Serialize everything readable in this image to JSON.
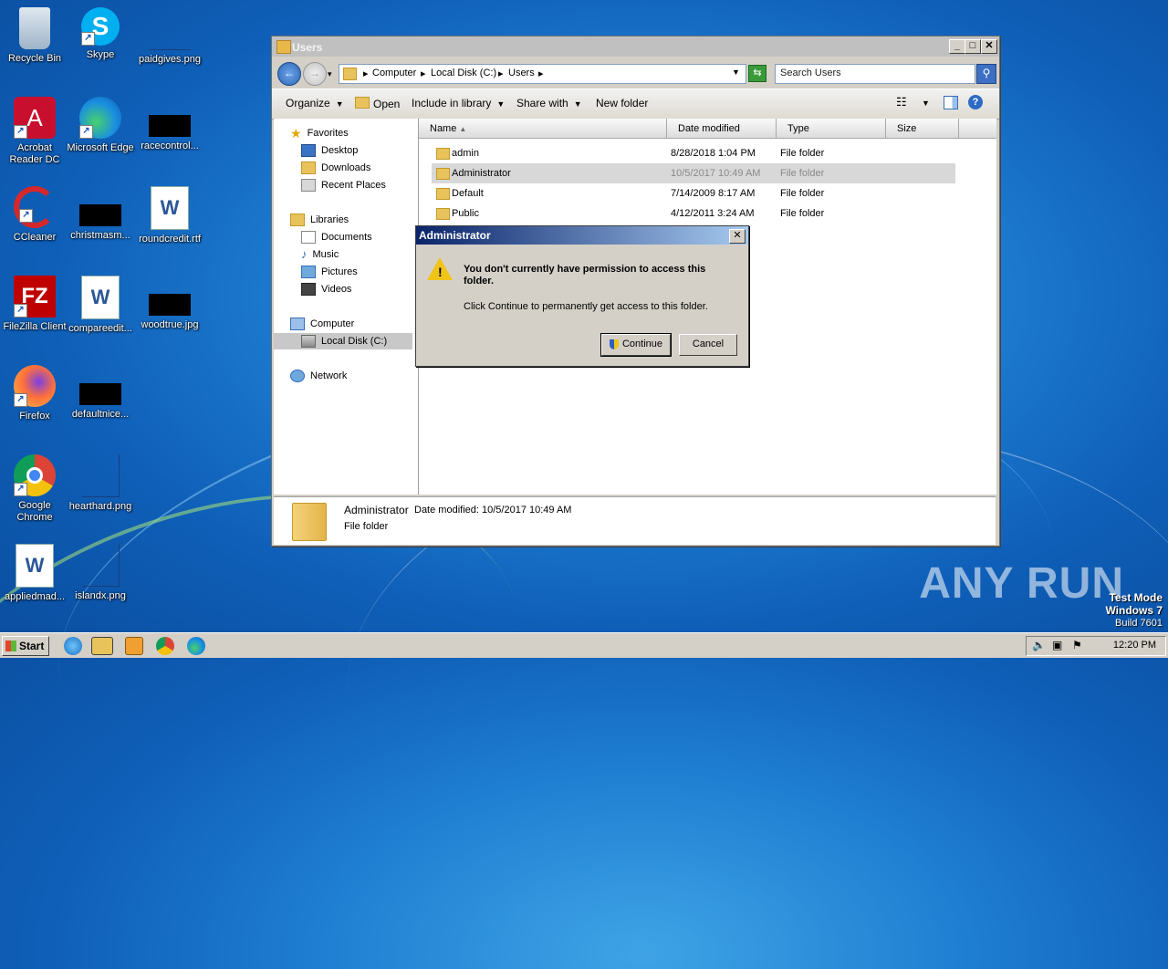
{
  "desktop": {
    "icons": [
      {
        "label": "Recycle Bin"
      },
      {
        "label": "Skype"
      },
      {
        "label": "paidgives.png"
      },
      {
        "label": "Acrobat Reader DC"
      },
      {
        "label": "Microsoft Edge"
      },
      {
        "label": "racecontrol..."
      },
      {
        "label": "CCleaner"
      },
      {
        "label": "christmasm..."
      },
      {
        "label": "roundcredit.rtf"
      },
      {
        "label": "FileZilla Client"
      },
      {
        "label": "compareedit..."
      },
      {
        "label": "woodtrue.jpg"
      },
      {
        "label": "Firefox"
      },
      {
        "label": "defaultnice..."
      },
      {
        "label": "Google Chrome"
      },
      {
        "label": "hearthard.png"
      },
      {
        "label": "appliedmad..."
      },
      {
        "label": "islandx.png"
      }
    ]
  },
  "explorer": {
    "title": "Users",
    "breadcrumb": [
      "Computer",
      "Local Disk (C:)",
      "Users"
    ],
    "search_placeholder": "Search Users",
    "toolbar": {
      "organize": "Organize",
      "open": "Open",
      "include_in_library": "Include in library",
      "share_with": "Share with",
      "new_folder": "New folder"
    },
    "nav": {
      "favorites": "Favorites",
      "desktop": "Desktop",
      "downloads": "Downloads",
      "recent_places": "Recent Places",
      "libraries": "Libraries",
      "documents": "Documents",
      "music": "Music",
      "pictures": "Pictures",
      "videos": "Videos",
      "computer": "Computer",
      "local_disk": "Local Disk (C:)",
      "network": "Network"
    },
    "columns": {
      "name": "Name",
      "date_modified": "Date modified",
      "type": "Type",
      "size": "Size"
    },
    "rows": [
      {
        "name": "admin",
        "date": "8/28/2018 1:04 PM",
        "type": "File folder"
      },
      {
        "name": "Administrator",
        "date": "10/5/2017 10:49 AM",
        "type": "File folder"
      },
      {
        "name": "Default",
        "date": "7/14/2009 8:17 AM",
        "type": "File folder"
      },
      {
        "name": "Public",
        "date": "4/12/2011 3:24 AM",
        "type": "File folder"
      }
    ],
    "details": {
      "name": "Administrator",
      "date_label": "Date modified:",
      "date": "10/5/2017 10:49 AM",
      "type": "File folder"
    }
  },
  "dialog": {
    "title": "Administrator",
    "message": "You don't currently have permission to access this folder.",
    "sub": "Click Continue to permanently get access to this folder.",
    "continue": "Continue",
    "cancel": "Cancel"
  },
  "taskbar": {
    "start": "Start",
    "clock": "12:20 PM"
  },
  "watermark": {
    "brand": "ANY RUN",
    "line1": "Test Mode",
    "line2": "Windows 7",
    "line3": "Build 7601"
  }
}
